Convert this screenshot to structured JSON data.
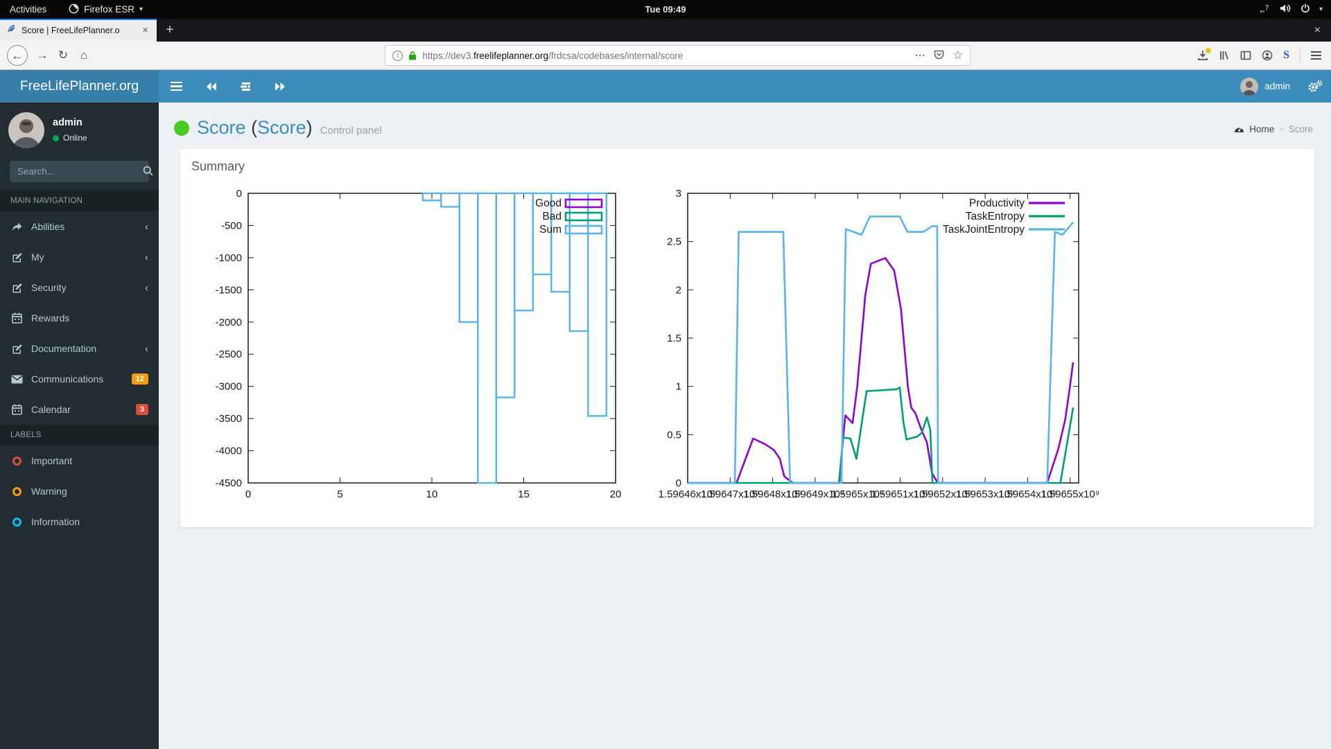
{
  "system_bar": {
    "activities_label": "Activities",
    "app_name": "Firefox ESR",
    "clock": "Tue 09:49"
  },
  "browser": {
    "tab_title": "Score | FreeLifePlanner.o",
    "new_tab_button": "+",
    "url_prefix": "https://dev3.",
    "url_domain": "freelifeplanner.org",
    "url_path": "/frdcsa/codebases/internal/score",
    "s_extension_label": "S"
  },
  "glyphs": {
    "close": "×",
    "caret_down": "▾",
    "back": "←",
    "forward": "→",
    "reload": "↻",
    "home": "⌂",
    "ellipsis": "⋯",
    "star": "☆",
    "info": "i",
    "chevron_left": "‹",
    "breadcrumb_sep": ">"
  },
  "navbar": {
    "brand": "FreeLifePlanner.org",
    "username": "admin"
  },
  "sidebar": {
    "username": "admin",
    "status": "Online",
    "status_color": "#00a65a",
    "search_placeholder": "Search...",
    "nav_header": "MAIN NAVIGATION",
    "items": [
      {
        "label": "Abilities",
        "icon": "share-icon",
        "chevron": "‹"
      },
      {
        "label": "My",
        "icon": "edit-icon",
        "chevron": "‹"
      },
      {
        "label": "Security",
        "icon": "edit-icon",
        "chevron": "‹"
      },
      {
        "label": "Rewards",
        "icon": "calendar-icon"
      },
      {
        "label": "Documentation",
        "icon": "edit-icon",
        "chevron": "‹"
      },
      {
        "label": "Communications",
        "icon": "envelope-icon",
        "badge": "12",
        "badge_color": "#f39c12"
      },
      {
        "label": "Calendar",
        "icon": "calendar-icon",
        "badge": "3",
        "badge_color": "#dd4b39"
      }
    ],
    "labels_header": "LABELS",
    "labels": [
      {
        "label": "Important",
        "color": "#dd4b39"
      },
      {
        "label": "Warning",
        "color": "#f39c12"
      },
      {
        "label": "Information",
        "color": "#00c0ef"
      }
    ]
  },
  "content": {
    "status_color": "#47cd22",
    "title_primary": "Score",
    "paren_open": "(",
    "title_secondary": "Score",
    "paren_close": ")",
    "subtitle": "Control panel",
    "breadcrumb_home": "Home",
    "breadcrumb_current": "Score",
    "card_title": "Summary"
  },
  "chart_data": [
    {
      "type": "boxes",
      "title": "",
      "xlabel": "",
      "ylabel": "",
      "xlim": [
        0,
        20
      ],
      "ylim": [
        -4500,
        0
      ],
      "grid": false,
      "legend_position": "top-right",
      "xticks": [
        {
          "v": 0,
          "label": "0"
        },
        {
          "v": 5,
          "label": "5"
        },
        {
          "v": 10,
          "label": "10"
        },
        {
          "v": 15,
          "label": "15"
        },
        {
          "v": 20,
          "label": "20"
        }
      ],
      "yticks": [
        {
          "v": 0,
          "label": "0"
        },
        {
          "v": -500,
          "label": "-500"
        },
        {
          "v": -1000,
          "label": "-1000"
        },
        {
          "v": -1500,
          "label": "-1500"
        },
        {
          "v": -2000,
          "label": "-2000"
        },
        {
          "v": -2500,
          "label": "-2500"
        },
        {
          "v": -3000,
          "label": "-3000"
        },
        {
          "v": -3500,
          "label": "-3500"
        },
        {
          "v": -4000,
          "label": "-4000"
        },
        {
          "v": -4500,
          "label": "-4500"
        }
      ],
      "series": [
        {
          "name": "Good",
          "color": "#9400d3",
          "box_width": 1,
          "boxes": []
        },
        {
          "name": "Bad",
          "color": "#009e73",
          "box_width": 1,
          "boxes": []
        },
        {
          "name": "Sum",
          "color": "#56b4e9",
          "box_width": 1,
          "boxes": [
            {
              "x": 10,
              "y": -110
            },
            {
              "x": 11,
              "y": -210
            },
            {
              "x": 12,
              "y": -2000
            },
            {
              "x": 13,
              "y": -4500
            },
            {
              "x": 14,
              "y": -3170
            },
            {
              "x": 15,
              "y": -1820
            },
            {
              "x": 16,
              "y": -1260
            },
            {
              "x": 17,
              "y": -1530
            },
            {
              "x": 18,
              "y": -2140
            },
            {
              "x": 19,
              "y": -3460
            }
          ]
        }
      ]
    },
    {
      "type": "line",
      "title": "",
      "xlabel": "",
      "ylabel": "",
      "xlim": [
        1596460000,
        1596552000
      ],
      "ylim": [
        0,
        3
      ],
      "grid": false,
      "legend_position": "top-right",
      "xticks": [
        {
          "v": 1596460000,
          "label": "1.59646x10⁹"
        },
        {
          "v": 1596470000,
          "label": "1.59647x10⁹"
        },
        {
          "v": 1596480000,
          "label": "1.59648x10⁹"
        },
        {
          "v": 1596490000,
          "label": "1.59649x10⁹"
        },
        {
          "v": 1596500000,
          "label": "1.5965x10⁹"
        },
        {
          "v": 1596510000,
          "label": "1.59651x10⁹"
        },
        {
          "v": 1596520000,
          "label": "1.59652x10⁹"
        },
        {
          "v": 1596530000,
          "label": "1.59653x10⁹"
        },
        {
          "v": 1596540000,
          "label": "1.59654x10⁹"
        },
        {
          "v": 1596550000,
          "label": "1.59655x10⁹"
        }
      ],
      "yticks": [
        {
          "v": 0,
          "label": "0"
        },
        {
          "v": 0.5,
          "label": "0.5"
        },
        {
          "v": 1,
          "label": "1"
        },
        {
          "v": 1.5,
          "label": "1.5"
        },
        {
          "v": 2,
          "label": "2"
        },
        {
          "v": 2.5,
          "label": "2.5"
        },
        {
          "v": 3,
          "label": "3"
        }
      ],
      "series": [
        {
          "name": "Productivity",
          "color": "#9400d3",
          "points": [
            [
              1596460000,
              0
            ],
            [
              1596471500,
              0
            ],
            [
              1596475400,
              0.46
            ],
            [
              1596478300,
              0.4
            ],
            [
              1596480300,
              0.34
            ],
            [
              1596481700,
              0.25
            ],
            [
              1596482700,
              0.07
            ],
            [
              1596484100,
              0.02
            ],
            [
              1596484800,
              0
            ],
            [
              1596495600,
              0
            ],
            [
              1596497100,
              0.7
            ],
            [
              1596498800,
              0.62
            ],
            [
              1596499900,
              1.0
            ],
            [
              1596501800,
              1.95
            ],
            [
              1596503100,
              2.27
            ],
            [
              1596506500,
              2.33
            ],
            [
              1596508600,
              2.2
            ],
            [
              1596510200,
              1.8
            ],
            [
              1596511800,
              1.0
            ],
            [
              1596512600,
              0.78
            ],
            [
              1596513600,
              0.72
            ],
            [
              1596515000,
              0.55
            ],
            [
              1596516300,
              0.42
            ],
            [
              1596517500,
              0.1
            ],
            [
              1596518600,
              0.02
            ],
            [
              1596519200,
              0
            ],
            [
              1596544600,
              0
            ],
            [
              1596547200,
              0.35
            ],
            [
              1596548800,
              0.65
            ],
            [
              1596549800,
              0.95
            ],
            [
              1596550700,
              1.25
            ]
          ]
        },
        {
          "name": "TaskEntropy",
          "color": "#009e73",
          "points": [
            [
              1596460000,
              0
            ],
            [
              1596495700,
              0
            ],
            [
              1596496500,
              0.47
            ],
            [
              1596498300,
              0.46
            ],
            [
              1596499700,
              0.25
            ],
            [
              1596501400,
              0.75
            ],
            [
              1596502100,
              0.95
            ],
            [
              1596509200,
              0.97
            ],
            [
              1596509900,
              0.99
            ],
            [
              1596510800,
              0.62
            ],
            [
              1596511500,
              0.45
            ],
            [
              1596514000,
              0.48
            ],
            [
              1596515100,
              0.52
            ],
            [
              1596516300,
              0.68
            ],
            [
              1596517100,
              0.55
            ],
            [
              1596517600,
              0
            ],
            [
              1596544600,
              0
            ],
            [
              1596547700,
              0
            ],
            [
              1596550700,
              0.78
            ]
          ]
        },
        {
          "name": "TaskJointEntropy",
          "color": "#56b4e9",
          "points": [
            [
              1596460000,
              0
            ],
            [
              1596471100,
              0
            ],
            [
              1596472000,
              2.6
            ],
            [
              1596482500,
              2.6
            ],
            [
              1596484100,
              0
            ],
            [
              1596496200,
              0
            ],
            [
              1596497200,
              2.63
            ],
            [
              1596500900,
              2.57
            ],
            [
              1596502900,
              2.76
            ],
            [
              1596509900,
              2.76
            ],
            [
              1596511700,
              2.6
            ],
            [
              1596515500,
              2.6
            ],
            [
              1596517500,
              2.66
            ],
            [
              1596518700,
              2.66
            ],
            [
              1596518900,
              0
            ],
            [
              1596544600,
              0
            ],
            [
              1596546400,
              2.6
            ],
            [
              1596548200,
              2.57
            ],
            [
              1596550700,
              2.7
            ]
          ]
        }
      ]
    }
  ]
}
